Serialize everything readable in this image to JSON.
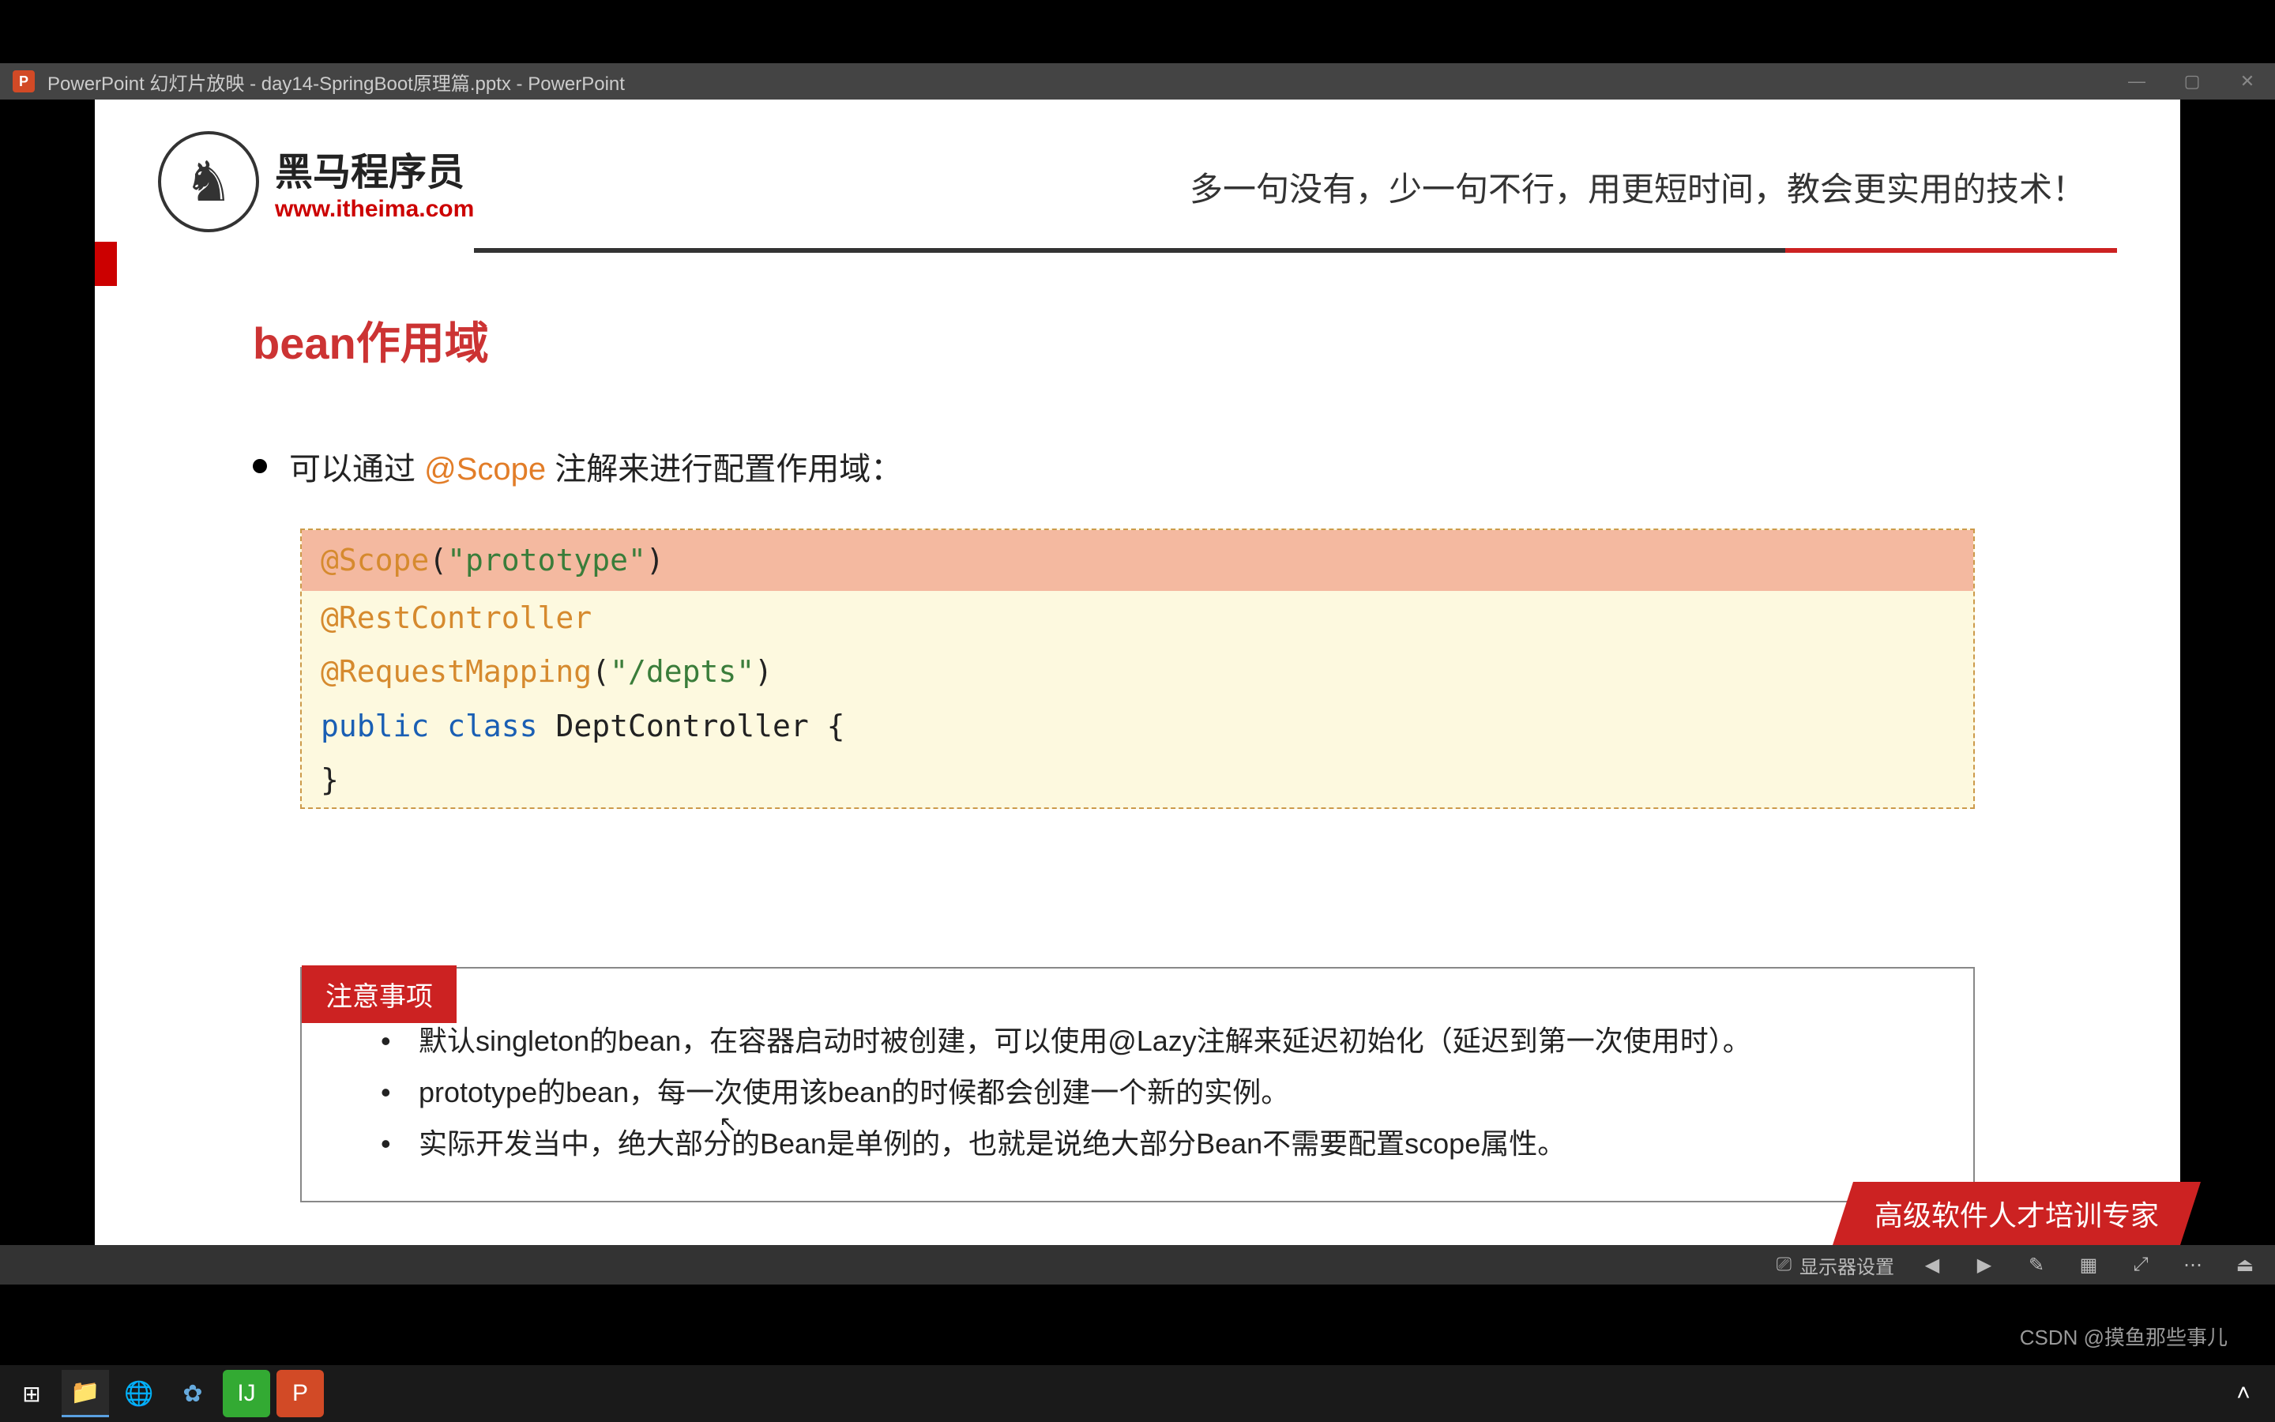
{
  "window": {
    "title": "PowerPoint 幻灯片放映 - day14-SpringBoot原理篇.pptx - PowerPoint"
  },
  "logo": {
    "zh": "黑马程序员",
    "en": "www.itheima.com",
    "glyph": "♞"
  },
  "slogan": "多一句没有，少一句不行，用更短时间，教会更实用的技术！",
  "title": "bean作用域",
  "intro": {
    "pre": "可以通过 ",
    "scope": "@Scope",
    "post": " 注解来进行配置作用域："
  },
  "code": {
    "l1": {
      "ann": "@Scope",
      "paren_open": "(",
      "str": "\"prototype\"",
      "paren_close": ")"
    },
    "l2": "@RestController",
    "l3": {
      "ann": "@RequestMapping",
      "paren_open": "(",
      "str": "\"/depts\"",
      "paren_close": ")"
    },
    "l4": {
      "kw1": "public",
      "kw2": "class",
      "id": "DeptController",
      "brace": "{"
    },
    "l5": "}"
  },
  "notes": {
    "label": "注意事项",
    "items": [
      "默认singleton的bean，在容器启动时被创建，可以使用@Lazy注解来延迟初始化（延迟到第一次使用时）。",
      "prototype的bean，每一次使用该bean的时候都会创建一个新的实例。",
      "实际开发当中，绝大部分的Bean是单例的，也就是说绝大部分Bean不需要配置scope属性。"
    ]
  },
  "footer_tag": "高级软件人才培训专家",
  "ppt_footer": {
    "display": "显示器设置"
  },
  "watermark": "CSDN @摸鱼那些事儿",
  "taskbar": {
    "start": "⊞"
  }
}
